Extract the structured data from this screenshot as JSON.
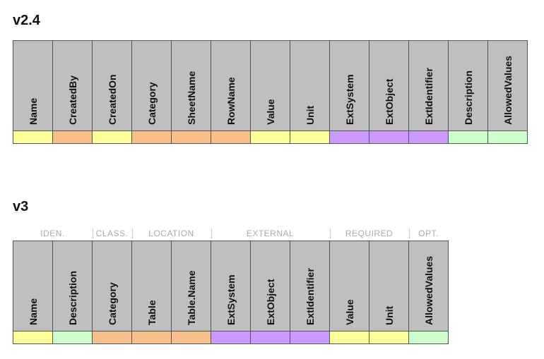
{
  "v24": {
    "title": "v2.4",
    "columns": [
      {
        "name": "Name",
        "color": "yellow"
      },
      {
        "name": "CreatedBy",
        "color": "orange"
      },
      {
        "name": "CreatedOn",
        "color": "yellow"
      },
      {
        "name": "Category",
        "color": "orange"
      },
      {
        "name": "SheetName",
        "color": "orange"
      },
      {
        "name": "RowName",
        "color": "orange"
      },
      {
        "name": "Value",
        "color": "yellow"
      },
      {
        "name": "Unit",
        "color": "yellow"
      },
      {
        "name": "ExtSystem",
        "color": "purple"
      },
      {
        "name": "ExtObject",
        "color": "purple"
      },
      {
        "name": "ExtIdentifier",
        "color": "purple"
      },
      {
        "name": "Description",
        "color": "green"
      },
      {
        "name": "AllowedValues",
        "color": "green"
      }
    ]
  },
  "v3": {
    "title": "v3",
    "groups": [
      {
        "label": "IDEN.",
        "span": 2
      },
      {
        "label": "CLASS.",
        "span": 1
      },
      {
        "label": "LOCATION",
        "span": 2
      },
      {
        "label": "EXTERNAL",
        "span": 3
      },
      {
        "label": "REQUIRED",
        "span": 2
      },
      {
        "label": "OPT.",
        "span": 1
      }
    ],
    "columns": [
      {
        "name": "Name",
        "color": "yellow"
      },
      {
        "name": "Description",
        "color": "green"
      },
      {
        "name": "Category",
        "color": "orange"
      },
      {
        "name": "Table",
        "color": "orange"
      },
      {
        "name": "Table.Name",
        "color": "orange"
      },
      {
        "name": "ExtSystem",
        "color": "purple"
      },
      {
        "name": "ExtObject",
        "color": "purple"
      },
      {
        "name": "ExtIdentifier",
        "color": "purple"
      },
      {
        "name": "Value",
        "color": "yellow"
      },
      {
        "name": "Unit",
        "color": "yellow"
      },
      {
        "name": "AllowedValues",
        "color": "green"
      }
    ]
  },
  "cellWidth": 56
}
